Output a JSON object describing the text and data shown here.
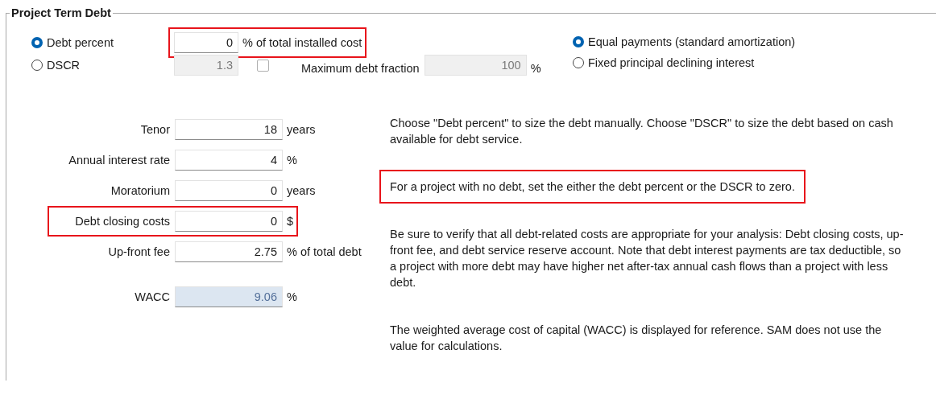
{
  "group": {
    "title": "Project Term Debt"
  },
  "sizing_options": [
    {
      "label": "Debt percent",
      "selected": true
    },
    {
      "label": "DSCR",
      "selected": false
    }
  ],
  "debt_percent": {
    "value": "0",
    "unit": "% of total installed cost",
    "highlighted": true
  },
  "dscr": {
    "value": "1.3",
    "disabled": true
  },
  "max_debt": {
    "checked": false,
    "label": "Maximum debt fraction",
    "value": "100",
    "unit": "%",
    "disabled": true
  },
  "payment_options": [
    {
      "label": "Equal payments (standard amortization)",
      "selected": true
    },
    {
      "label": "Fixed principal declining interest",
      "selected": false
    }
  ],
  "fields": [
    {
      "label": "Tenor",
      "value": "18",
      "unit": "years",
      "kind": "input",
      "highlighted": false
    },
    {
      "label": "Annual interest rate",
      "value": "4",
      "unit": "%",
      "kind": "input",
      "highlighted": false
    },
    {
      "label": "Moratorium",
      "value": "0",
      "unit": "years",
      "kind": "input",
      "highlighted": false
    },
    {
      "label": "Debt closing costs",
      "value": "0",
      "unit": "$",
      "kind": "input",
      "highlighted": true
    },
    {
      "label": "Up-front fee",
      "value": "2.75",
      "unit": "% of total debt",
      "kind": "input",
      "highlighted": false
    },
    {
      "label": "WACC",
      "value": "9.06",
      "unit": "%",
      "kind": "computed",
      "highlighted": false
    }
  ],
  "notes": [
    {
      "text": "Choose \"Debt percent\" to size the debt manually. Choose \"DSCR\" to size the debt based on cash available for debt service.",
      "highlighted": false
    },
    {
      "text": "For a project with no debt, set the either the debt percent or the DSCR to zero.",
      "highlighted": true
    },
    {
      "text": "Be sure to verify that all debt-related costs are appropriate for your analysis: Debt closing costs, up-front fee, and debt service reserve account. Note that debt interest payments are tax deductible, so a project with more debt may have higher net after-tax annual cash flows than a project with less debt.",
      "highlighted": false
    },
    {
      "text": "The weighted average cost of capital (WACC) is displayed for reference. SAM does not use the value for calculations.",
      "highlighted": false
    }
  ]
}
